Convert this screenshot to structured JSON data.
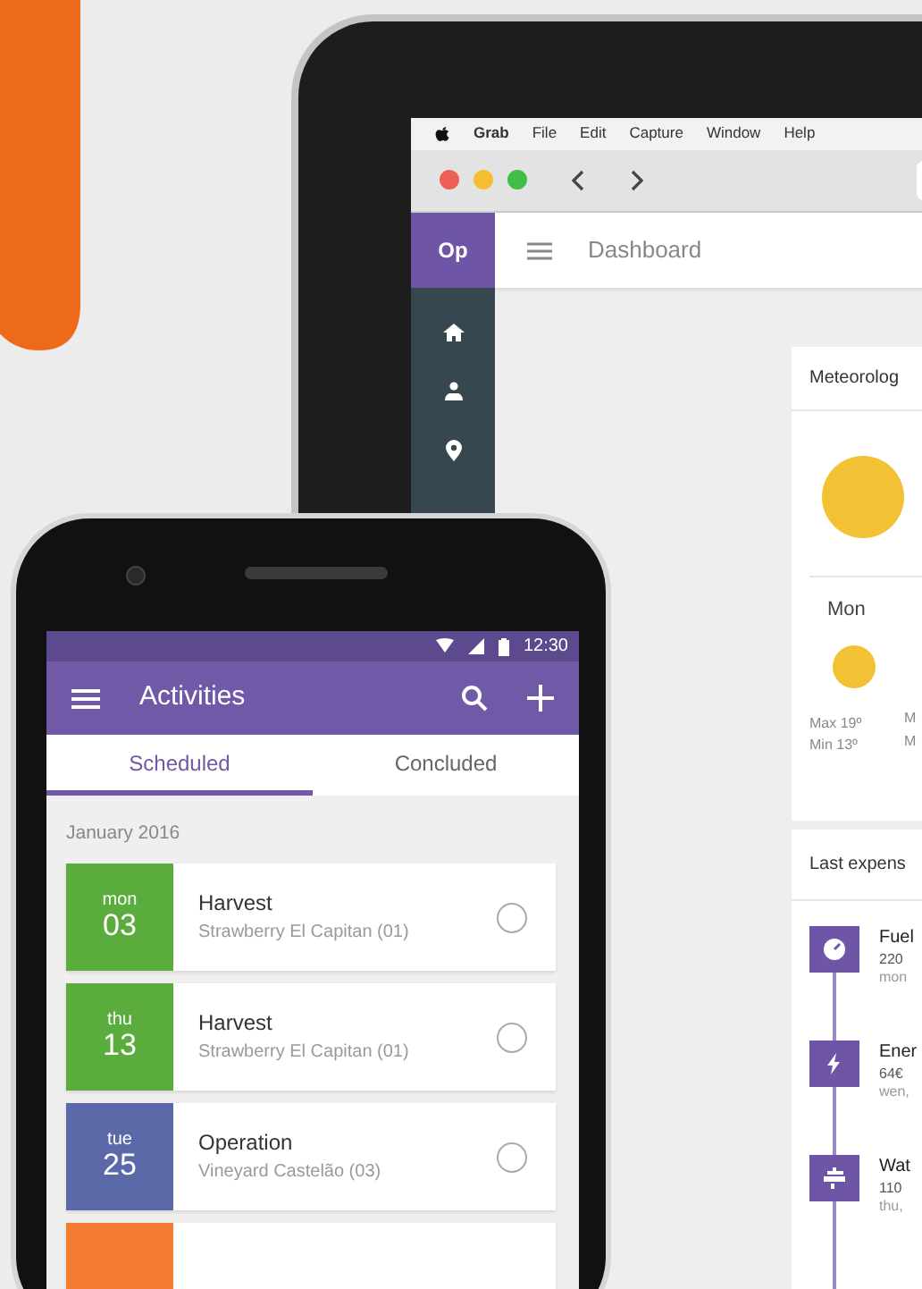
{
  "laptop": {
    "menu_bar": {
      "app_name": "Grab",
      "menus": [
        "File",
        "Edit",
        "Capture",
        "Window",
        "Help"
      ]
    },
    "app": {
      "logo": "Op",
      "title": "Dashboard",
      "weather_card": {
        "title": "Meteorolog",
        "day": "Mon",
        "max": "Max 19º",
        "min": "Min 13º",
        "next_max": "M",
        "next_min": "M"
      },
      "expenses_card": {
        "title": "Last expens",
        "items": [
          {
            "kind": "fuel",
            "name": "Fuel",
            "amount": "220",
            "date": "mon"
          },
          {
            "kind": "energy",
            "name": "Ener",
            "amount": "64€",
            "date": "wen,"
          },
          {
            "kind": "water",
            "name": "Wat",
            "amount": "110",
            "date": "thu,"
          }
        ]
      }
    }
  },
  "phone": {
    "status_bar": {
      "time": "12:30"
    },
    "app_bar": {
      "title": "Activities"
    },
    "tabs": [
      {
        "label": "Scheduled",
        "selected": true
      },
      {
        "label": "Concluded",
        "selected": false
      }
    ],
    "month": "January 2016",
    "activities": [
      {
        "weekday": "mon",
        "day": "03",
        "title": "Harvest",
        "place": "Strawberry El Capitan (01)",
        "color": "#5aad3c",
        "checked": false
      },
      {
        "weekday": "thu",
        "day": "13",
        "title": "Harvest",
        "place": "Strawberry El Capitan (01)",
        "color": "#5aad3c",
        "checked": false
      },
      {
        "weekday": "tue",
        "day": "25",
        "title": "Operation",
        "place": "Vineyard Castelão (03)",
        "color": "#5b69a8",
        "checked": false
      },
      {
        "color": "#f47b32"
      }
    ]
  }
}
